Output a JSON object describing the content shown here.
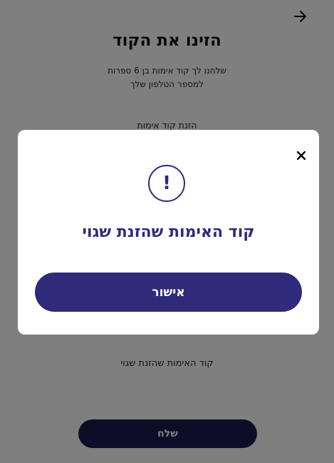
{
  "header": {
    "back_icon": "arrow-right-icon",
    "title": "הזינו את הקוד",
    "subtitle_line1": "שלחנו לך קוד אימות בן 6 ספרות",
    "subtitle_line2": "למספר הטלפון שלך"
  },
  "form": {
    "code_label": "הזנת קוד אימות",
    "error_message": "קוד האימות שהזנת שגוי",
    "send_label": "שלח"
  },
  "modal": {
    "close_icon": "close-icon",
    "alert_icon": "exclamation-circle-icon",
    "alert_glyph": "!",
    "message": "קוד האימות שהזנת שגוי",
    "confirm_label": "אישור"
  },
  "colors": {
    "brand": "#2f2a7a",
    "send_button": "#1a1a4e",
    "overlay": "rgba(0,0,0,0.5)"
  }
}
